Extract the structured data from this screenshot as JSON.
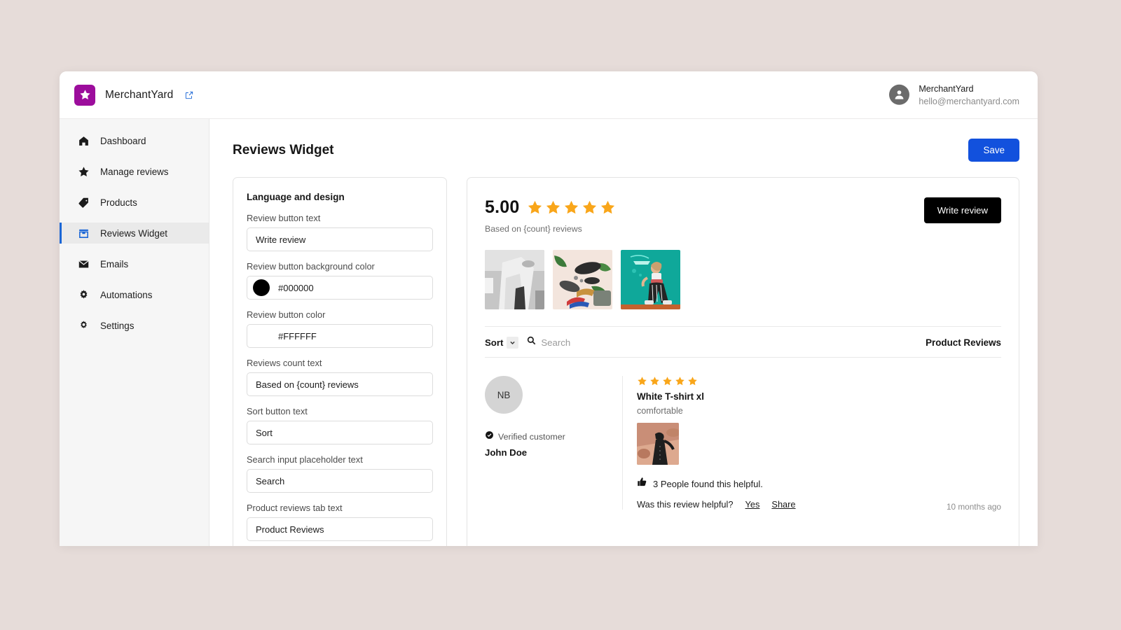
{
  "app": {
    "brand_name": "MerchantYard",
    "logo_icon": "star-icon",
    "external_link_icon": "external-link-icon",
    "user": {
      "name": "MerchantYard",
      "email": "hello@merchantyard.com",
      "avatar_icon": "person-icon"
    }
  },
  "sidebar": {
    "items": [
      {
        "label": "Dashboard",
        "icon": "home-icon",
        "active": false
      },
      {
        "label": "Manage reviews",
        "icon": "star-icon",
        "active": false
      },
      {
        "label": "Products",
        "icon": "tag-icon",
        "active": false
      },
      {
        "label": "Reviews Widget",
        "icon": "storefront-icon",
        "active": true
      },
      {
        "label": "Emails",
        "icon": "envelope-icon",
        "active": false
      },
      {
        "label": "Automations",
        "icon": "gears-icon",
        "active": false
      },
      {
        "label": "Settings",
        "icon": "gear-icon",
        "active": false
      }
    ]
  },
  "page": {
    "title": "Reviews Widget",
    "save_label": "Save",
    "save_color": "#1251dd"
  },
  "settings_panel": {
    "title": "Language and design",
    "fields": [
      {
        "label": "Review button text",
        "value": "Write review",
        "type": "text"
      },
      {
        "label": "Review button background color",
        "value": "#000000",
        "type": "color",
        "swatch": "#000000"
      },
      {
        "label": "Review button color",
        "value": "#FFFFFF",
        "type": "color",
        "swatch": "#FFFFFF"
      },
      {
        "label": "Reviews count text",
        "value": "Based on {count} reviews",
        "type": "text"
      },
      {
        "label": "Sort button text",
        "value": "Sort",
        "type": "text"
      },
      {
        "label": "Search input placeholder text",
        "value": "Search",
        "type": "text"
      },
      {
        "label": "Product reviews tab text",
        "value": "Product Reviews",
        "type": "text"
      }
    ]
  },
  "preview": {
    "rating_score": "5.00",
    "rating_stars": 5,
    "rating_count_text": "Based on {count} reviews",
    "write_review_label": "Write review",
    "write_review_bg": "#000000",
    "write_review_color": "#FFFFFF",
    "gallery": [
      {
        "name": "gallery-thumb-1",
        "alt": "Person in white outfit, black and white photo"
      },
      {
        "name": "gallery-thumb-2",
        "alt": "Flat lay of shoes, sunglasses, scarf and bag"
      },
      {
        "name": "gallery-thumb-3",
        "alt": "Model in striped trousers on teal background"
      }
    ],
    "toolbar": {
      "sort_label": "Sort",
      "sort_chevron_icon": "chevron-down-icon",
      "search_icon": "search-icon",
      "search_placeholder": "Search",
      "tab_label": "Product Reviews"
    },
    "review": {
      "avatar_initials": "NB",
      "verified_icon": "check-circle-icon",
      "verified_text": "Verified customer",
      "author_name": "John Doe",
      "stars": 5,
      "title": "White T-shirt xl",
      "text": "comfortable",
      "photo_alt": "Person in dark dress on pink rock landscape",
      "helpful_icon": "thumbs-up-icon",
      "helpful_count_text": "3 People found this helpful.",
      "helpful_question": "Was this review helpful?",
      "yes_label": "Yes",
      "share_label": "Share",
      "timestamp": "10 months ago"
    }
  },
  "colors": {
    "page_background": "#e6dcd9",
    "brand_purple": "#9c0d9c",
    "accent_blue": "#1a66d6",
    "star_orange": "#f9a61a"
  }
}
